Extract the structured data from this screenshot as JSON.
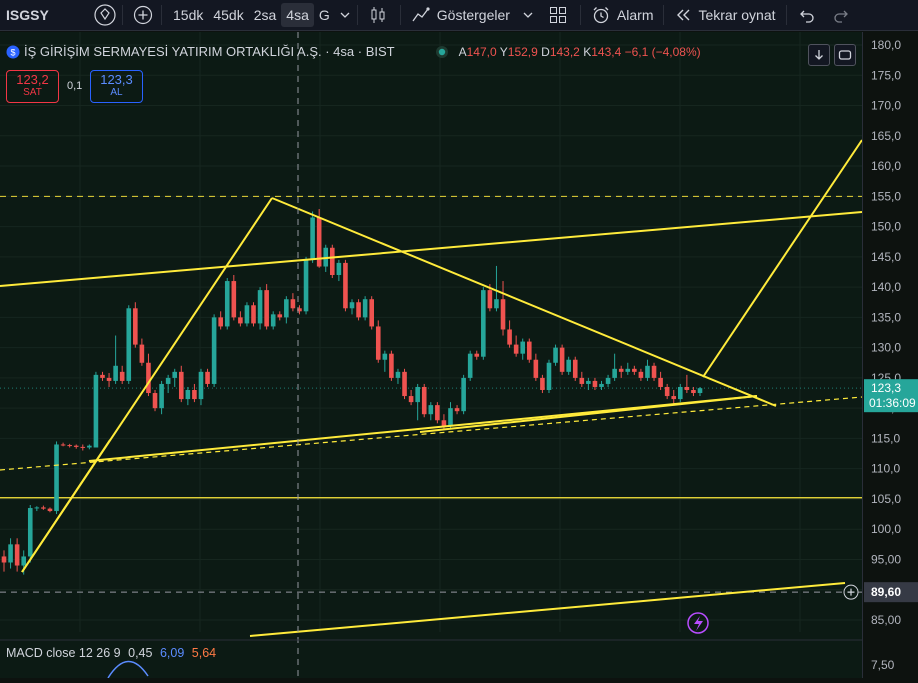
{
  "toolbar": {
    "symbol": "ISGSY",
    "timeframes": [
      "15dk",
      "45dk",
      "2sa",
      "4sa",
      "G"
    ],
    "active_timeframe": "4sa",
    "indicators_label": "Göstergeler",
    "alarm_label": "Alarm",
    "replay_label": "Tekrar oynat"
  },
  "legend": {
    "title": "İŞ GİRİŞİM SERMAYESİ YATIRIM ORTAKLIĞI A.Ş. · 4sa · BIST",
    "open_label": "A",
    "open": "147,0",
    "high_label": "Y",
    "high": "152,9",
    "low_label": "D",
    "low": "143,2",
    "close_label": "K",
    "close": "143,4",
    "change": "−6,1 (−4,08%)"
  },
  "trade": {
    "sell_price": "123,2",
    "sell_label": "SAT",
    "spread": "0,1",
    "buy_price": "123,3",
    "buy_label": "AL"
  },
  "price_axis": {
    "current_price": "123,3",
    "countdown": "01:36:09",
    "crosshair_price": "89,60",
    "macd_tick": "7,50"
  },
  "macd": {
    "label": "MACD close 12 26 9",
    "macd": "0,45",
    "signal": "6,09",
    "hist": "5,64"
  },
  "colors": {
    "up": "#26a69a",
    "down": "#ef5350",
    "trendline": "#ffeb3b",
    "accent": "#2962ff",
    "macd_signal": "#5b8cff",
    "macd_hist": "#ff7a45"
  },
  "chart_data": {
    "type": "candlestick",
    "title": "İŞ GİRİŞİM SERMAYESİ YATIRIM ORTAKLIĞI A.Ş. · 4sa · BIST",
    "y_ticks": [
      180,
      175,
      170,
      165,
      160,
      155,
      150,
      145,
      140,
      135,
      130,
      125,
      120,
      115,
      110,
      105,
      100,
      95,
      90,
      85
    ],
    "y_tick_labels": [
      "180,0",
      "175,0",
      "170,0",
      "165,0",
      "160,0",
      "155,0",
      "150,0",
      "145,0",
      "140,0",
      "135,0",
      "130,0",
      "125,0",
      "120,0",
      "115,0",
      "110,0",
      "105,0",
      "100,0",
      "95,00",
      "90,00",
      "85,00"
    ],
    "ylim": [
      83,
      182
    ],
    "grid": true,
    "horizontal_levels": [
      155,
      105.2,
      89.6
    ],
    "candles": [
      [
        95.5,
        96.5,
        93.0,
        94.5
      ],
      [
        94.5,
        98.5,
        93.5,
        97.5
      ],
      [
        97.5,
        98.5,
        93.0,
        94.0
      ],
      [
        94.0,
        96.5,
        92.5,
        95.5
      ],
      [
        95.5,
        104.0,
        94.5,
        103.5
      ],
      [
        103.5,
        103.8,
        103.0,
        103.6
      ],
      [
        103.6,
        103.9,
        103.2,
        103.4
      ],
      [
        103.4,
        103.6,
        102.8,
        103.0
      ],
      [
        103.0,
        114.5,
        102.5,
        114.0
      ],
      [
        114.0,
        114.3,
        113.7,
        113.9
      ],
      [
        113.9,
        114.1,
        113.5,
        113.8
      ],
      [
        113.8,
        114.0,
        113.3,
        113.6
      ],
      [
        113.6,
        114.0,
        113.0,
        113.5
      ],
      [
        113.5,
        114.0,
        113.2,
        113.8
      ],
      [
        113.5,
        126.0,
        119.0,
        125.5
      ],
      [
        125.5,
        126.0,
        124.5,
        125.0
      ],
      [
        125.0,
        125.8,
        123.5,
        124.5
      ],
      [
        124.5,
        132.0,
        124.0,
        127.0
      ],
      [
        126.0,
        127.0,
        124.0,
        124.5
      ],
      [
        124.5,
        137.0,
        124.0,
        136.5
      ],
      [
        136.5,
        137.5,
        130.0,
        130.5
      ],
      [
        130.5,
        131.5,
        127.0,
        127.5
      ],
      [
        127.5,
        129.0,
        122.0,
        122.5
      ],
      [
        122.5,
        123.0,
        119.5,
        120.0
      ],
      [
        120.0,
        124.5,
        119.0,
        124.0
      ],
      [
        124.0,
        125.5,
        122.5,
        125.0
      ],
      [
        125.0,
        126.5,
        123.5,
        126.0
      ],
      [
        126.0,
        127.0,
        121.0,
        121.5
      ],
      [
        121.5,
        123.5,
        120.5,
        123.0
      ],
      [
        123.0,
        124.0,
        121.0,
        121.5
      ],
      [
        121.5,
        126.5,
        120.5,
        126.0
      ],
      [
        126.0,
        126.5,
        123.5,
        124.0
      ],
      [
        124.0,
        135.5,
        123.5,
        135.0
      ],
      [
        135.0,
        136.0,
        133.0,
        133.5
      ],
      [
        133.5,
        141.5,
        133.0,
        141.0
      ],
      [
        141.0,
        142.0,
        134.5,
        135.0
      ],
      [
        135.0,
        136.0,
        133.5,
        134.0
      ],
      [
        134.0,
        137.5,
        133.5,
        137.0
      ],
      [
        137.0,
        137.5,
        133.5,
        134.0
      ],
      [
        134.0,
        140.0,
        133.0,
        139.5
      ],
      [
        139.5,
        140.5,
        133.0,
        133.5
      ],
      [
        133.5,
        136.0,
        133.0,
        135.5
      ],
      [
        135.5,
        136.0,
        134.5,
        135.0
      ],
      [
        135.0,
        138.5,
        134.0,
        138.0
      ],
      [
        138.0,
        139.0,
        136.0,
        136.5
      ],
      [
        136.5,
        137.0,
        135.5,
        136.0
      ],
      [
        136.0,
        145.0,
        135.5,
        144.5
      ],
      [
        144.5,
        152.5,
        144.0,
        151.5
      ],
      [
        151.5,
        152.9,
        143.2,
        143.4
      ],
      [
        143.4,
        147.0,
        142.5,
        146.5
      ],
      [
        146.5,
        147.0,
        141.5,
        142.0
      ],
      [
        142.0,
        144.5,
        141.0,
        144.0
      ],
      [
        144.0,
        144.5,
        136.0,
        136.5
      ],
      [
        136.5,
        138.0,
        135.5,
        137.5
      ],
      [
        137.5,
        138.0,
        134.5,
        135.0
      ],
      [
        135.0,
        138.5,
        134.5,
        138.0
      ],
      [
        138.0,
        138.5,
        133.0,
        133.5
      ],
      [
        133.5,
        134.5,
        127.5,
        128.0
      ],
      [
        128.0,
        129.5,
        126.0,
        129.0
      ],
      [
        129.0,
        129.5,
        124.5,
        125.0
      ],
      [
        125.0,
        126.5,
        124.0,
        126.0
      ],
      [
        126.0,
        126.5,
        121.5,
        122.0
      ],
      [
        122.0,
        123.0,
        120.5,
        121.0
      ],
      [
        121.0,
        124.0,
        118.0,
        123.5
      ],
      [
        123.5,
        124.0,
        118.5,
        119.0
      ],
      [
        119.0,
        121.0,
        118.0,
        120.5
      ],
      [
        120.5,
        121.0,
        117.5,
        118.0
      ],
      [
        118.0,
        119.0,
        116.5,
        117.0
      ],
      [
        117.0,
        121.0,
        116.5,
        120.0
      ],
      [
        120.0,
        120.5,
        119.0,
        119.5
      ],
      [
        119.5,
        125.5,
        119.0,
        125.0
      ],
      [
        125.0,
        129.5,
        124.5,
        129.0
      ],
      [
        129.0,
        129.5,
        128.0,
        128.5
      ],
      [
        128.5,
        140.0,
        128.0,
        139.5
      ],
      [
        139.5,
        140.5,
        136.0,
        136.5
      ],
      [
        136.5,
        143.5,
        136.0,
        138.0
      ],
      [
        138.0,
        141.0,
        132.0,
        133.0
      ],
      [
        133.0,
        134.5,
        130.0,
        130.5
      ],
      [
        130.5,
        132.0,
        128.5,
        129.0
      ],
      [
        129.0,
        131.5,
        128.0,
        131.0
      ],
      [
        131.0,
        131.5,
        127.5,
        128.0
      ],
      [
        128.0,
        129.0,
        124.5,
        125.0
      ],
      [
        125.0,
        125.5,
        122.5,
        123.0
      ],
      [
        123.0,
        128.0,
        122.5,
        127.5
      ],
      [
        127.5,
        130.5,
        127.0,
        130.0
      ],
      [
        130.0,
        130.5,
        125.5,
        126.0
      ],
      [
        126.0,
        128.5,
        125.5,
        128.0
      ],
      [
        128.0,
        128.5,
        124.5,
        125.0
      ],
      [
        125.0,
        126.0,
        123.5,
        124.0
      ],
      [
        124.0,
        125.0,
        123.0,
        124.5
      ],
      [
        124.5,
        125.0,
        123.0,
        123.5
      ],
      [
        123.5,
        124.5,
        123.0,
        124.0
      ],
      [
        124.0,
        125.5,
        123.5,
        125.0
      ],
      [
        125.0,
        129.0,
        124.5,
        126.5
      ],
      [
        126.5,
        127.0,
        125.0,
        126.0
      ],
      [
        126.0,
        127.5,
        125.5,
        126.5
      ],
      [
        126.5,
        127.0,
        125.5,
        126.0
      ],
      [
        126.0,
        126.5,
        124.5,
        125.0
      ],
      [
        125.0,
        128.0,
        124.5,
        127.0
      ],
      [
        127.0,
        127.5,
        124.5,
        125.0
      ],
      [
        125.0,
        126.0,
        123.0,
        123.5
      ],
      [
        123.5,
        124.0,
        121.5,
        122.0
      ],
      [
        122.0,
        123.0,
        120.5,
        121.5
      ],
      [
        121.5,
        124.0,
        121.0,
        123.5
      ],
      [
        123.5,
        125.5,
        122.5,
        123.0
      ],
      [
        123.0,
        123.5,
        122.0,
        122.5
      ],
      [
        122.5,
        123.5,
        122.0,
        123.3
      ]
    ]
  }
}
